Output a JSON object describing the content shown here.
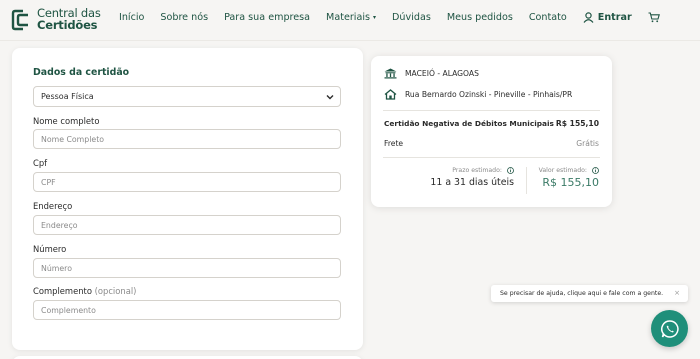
{
  "header": {
    "logo_line1": "Central das",
    "logo_line2": "Certidões",
    "nav": [
      "Início",
      "Sobre nós",
      "Para sua empresa",
      "Materiais",
      "Dúvidas",
      "Meus pedidos",
      "Contato"
    ],
    "login_label": "Entrar"
  },
  "form": {
    "section_title": "Dados da certidão",
    "person_type": "Pessoa Física",
    "fields": {
      "nome": {
        "label": "Nome completo",
        "placeholder": "Nome Completo"
      },
      "cpf": {
        "label": "Cpf",
        "placeholder": "CPF"
      },
      "endereco": {
        "label": "Endereço",
        "placeholder": "Endereço"
      },
      "numero": {
        "label": "Número",
        "placeholder": "Número"
      },
      "complemento": {
        "label": "Complemento",
        "optional": "(opcional)",
        "placeholder": "Complemento"
      }
    }
  },
  "summary": {
    "city": "MACEIÓ - ALAGOAS",
    "address": "Rua Bernardo Ozinski - Pineville - Pinhais/PR",
    "certificate_name": "Certidão Negativa de Débitos Municipais",
    "certificate_price": "R$ 155,10",
    "frete_label": "Frete",
    "frete_value": "Grátis",
    "prazo_label": "Prazo estimado:",
    "prazo_value": "11 a 31 dias úteis",
    "valor_label": "Valor estimado:",
    "valor_value": "R$ 155,10"
  },
  "chat": {
    "tip": "Se precisar de ajuda, clique aqui e fale com a gente.",
    "close": "×"
  },
  "colors": {
    "brand": "#1f5443",
    "accent": "#3a7a66",
    "whatsapp": "#1f8f7a",
    "background": "#f6f5f3"
  }
}
